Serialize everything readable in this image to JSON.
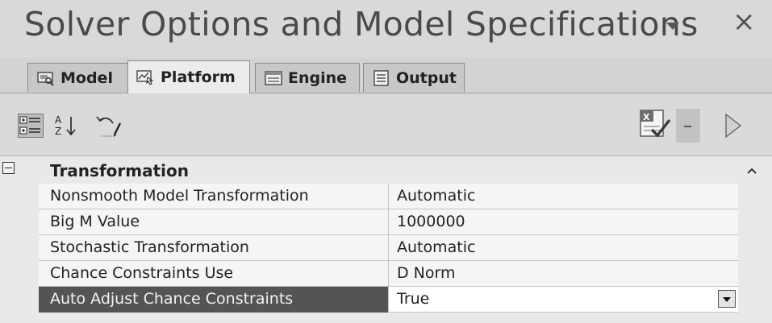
{
  "window": {
    "title": "Solver Options and Model Specifications",
    "close_glyph": "×"
  },
  "tabs": [
    {
      "label": "Model",
      "icon": "model-icon",
      "active": false
    },
    {
      "label": "Platform",
      "icon": "platform-icon",
      "active": true
    },
    {
      "label": "Engine",
      "icon": "engine-icon",
      "active": false
    },
    {
      "label": "Output",
      "icon": "output-icon",
      "active": false
    }
  ],
  "toolbar": {
    "sort_az_glyph": "A\nZ↓",
    "items": [
      "categorized-view-icon",
      "sort-alphabetical-icon",
      "undo-icon",
      "excel-check-icon",
      "dropdown-arrow-icon",
      "run-arrow-icon"
    ]
  },
  "grid": {
    "category": {
      "label": "Transformation",
      "expanded": true
    },
    "rows": [
      {
        "name": "Nonsmooth Model Transformation",
        "value": "Automatic",
        "selected": false
      },
      {
        "name": "Big M Value",
        "value": "1000000",
        "selected": false
      },
      {
        "name": "Stochastic Transformation",
        "value": "Automatic",
        "selected": false
      },
      {
        "name": "Chance Constraints Use",
        "value": "D Norm",
        "selected": false
      },
      {
        "name": "Auto Adjust Chance Constraints",
        "value": "True",
        "selected": true
      }
    ]
  },
  "colors": {
    "selected_row": "#545454",
    "background": "#d6d6d6"
  }
}
